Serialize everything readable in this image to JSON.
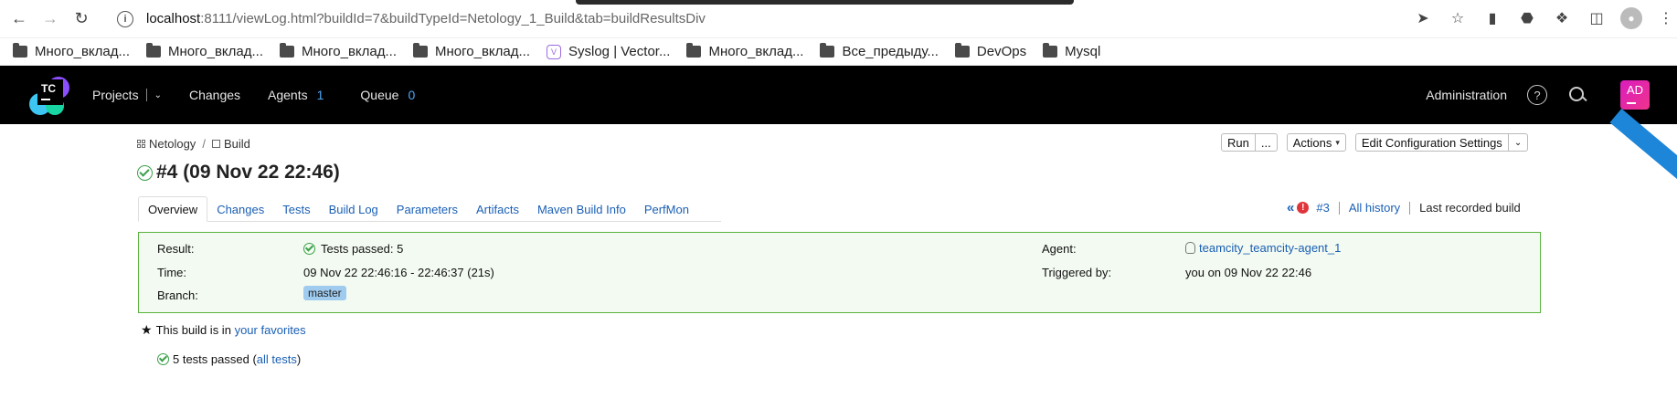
{
  "browser": {
    "url_host": "localhost",
    "url_rest": ":8111/viewLog.html?buildId=7&buildTypeId=Netology_1_Build&tab=buildResultsDiv",
    "bookmarks": [
      "Много_вклад...",
      "Много_вклад...",
      "Много_вклад...",
      "Много_вклад...",
      "Syslog | Vector...",
      "Много_вклад...",
      "Все_предыду...",
      "DevOps",
      "Mysql"
    ]
  },
  "header": {
    "logo_text": "TC",
    "projects": "Projects",
    "changes": "Changes",
    "agents": "Agents",
    "agents_count": "1",
    "queue": "Queue",
    "queue_count": "0",
    "administration": "Administration",
    "avatar_initials": "AD"
  },
  "breadcrumb": {
    "project": "Netology",
    "separator": "/",
    "build_config": "Build"
  },
  "actions": {
    "run": "Run",
    "run_more": "...",
    "actions": "Actions",
    "edit_config": "Edit Configuration Settings"
  },
  "build": {
    "title": "#4 (09 Nov 22 22:46)"
  },
  "tabs": [
    "Overview",
    "Changes",
    "Tests",
    "Build Log",
    "Parameters",
    "Artifacts",
    "Maven Build Info",
    "PerfMon"
  ],
  "history": {
    "prev_build": "#3",
    "all_history": "All history",
    "last_recorded": "Last recorded build"
  },
  "results": {
    "result_label": "Result:",
    "result_value": "Tests passed: 5",
    "time_label": "Time:",
    "time_value": "09 Nov 22 22:46:16 - 22:46:37 (21s)",
    "branch_label": "Branch:",
    "branch_value": "master",
    "agent_label": "Agent:",
    "agent_value": "teamcity_teamcity-agent_1",
    "triggered_label": "Triggered by:",
    "triggered_value": "you on 09 Nov 22 22:46"
  },
  "favorites": {
    "text": "This build is in",
    "link": "your favorites"
  },
  "tests": {
    "text": "5 tests passed (",
    "link": "all tests",
    "close": ")"
  },
  "colors": {
    "accent_blue": "#1a5fb4",
    "success_green": "#3aa14a",
    "error_red": "#e0343a",
    "header_bg": "#000000"
  }
}
